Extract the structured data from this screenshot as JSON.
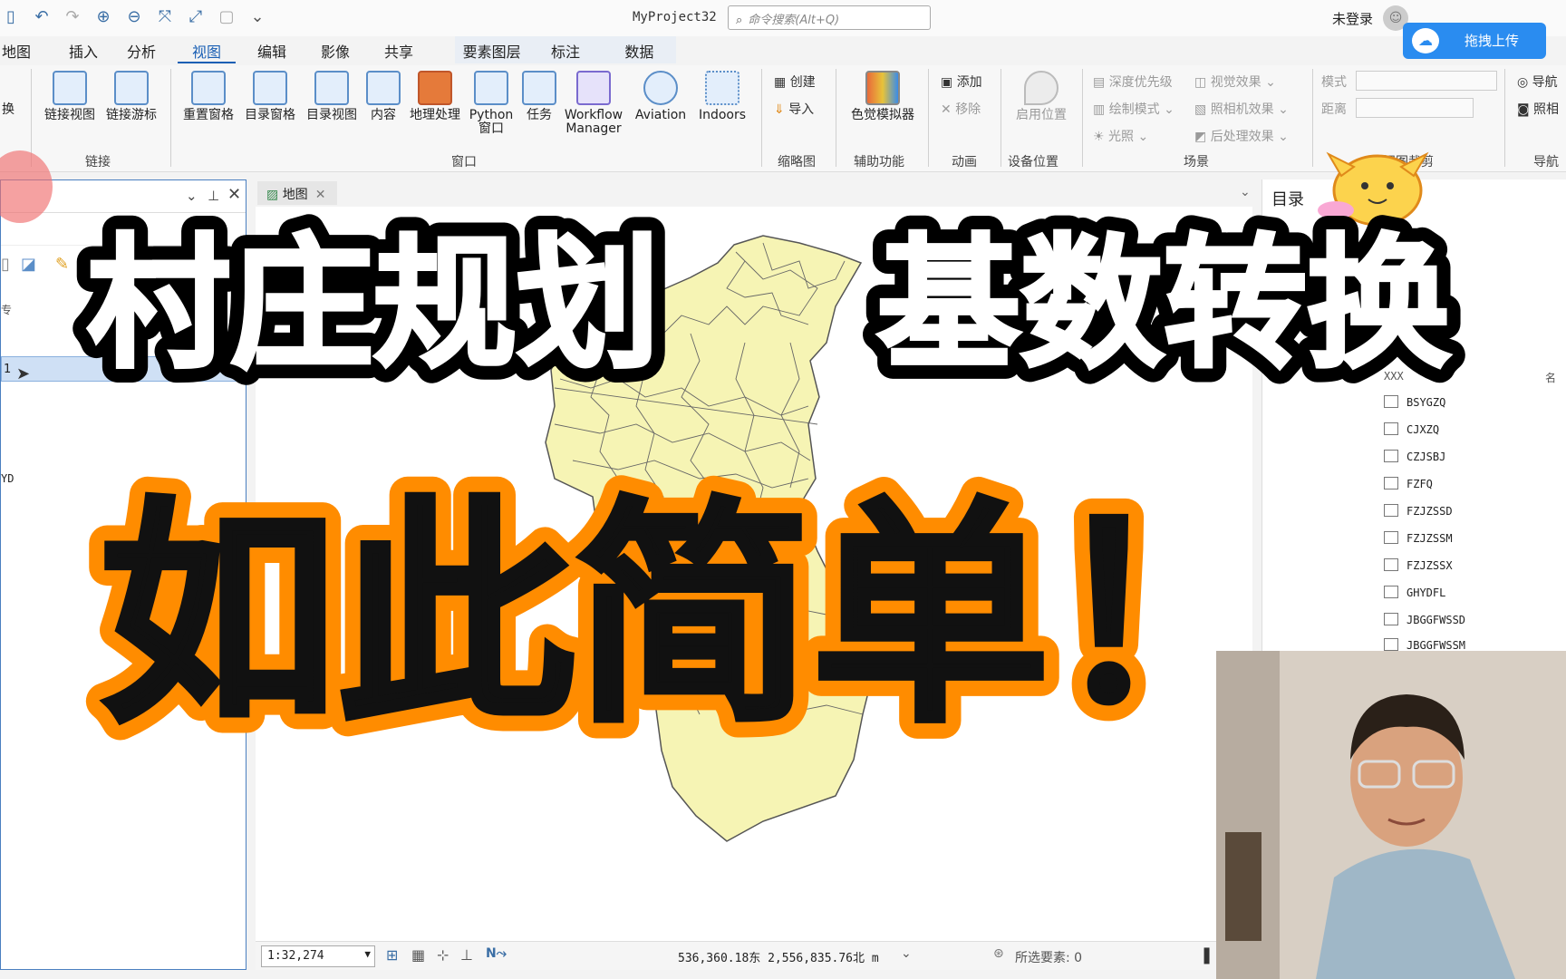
{
  "window": {
    "project_title": "MyProject32",
    "search_placeholder": "命令搜索(Alt+Q)",
    "signin_label": "未登录",
    "upload_button": "拖拽上传"
  },
  "ribbon_tabs": [
    "地图",
    "插入",
    "分析",
    "视图",
    "编辑",
    "影像",
    "共享"
  ],
  "active_tab": "视图",
  "context_tabs": [
    "要素图层",
    "标注",
    "数据"
  ],
  "ribbon": {
    "partial_left_label": "换",
    "link_group": {
      "label": "链接",
      "buttons": [
        "链接视图",
        "链接游标"
      ]
    },
    "window_group": {
      "label": "窗口",
      "buttons": [
        "重置窗格",
        "目录窗格",
        "目录视图",
        "内容",
        "地理处理",
        "Python\n窗口",
        "任务",
        "Workflow\nManager",
        "Aviation",
        "Indoors"
      ]
    },
    "overview_group": {
      "label": "缩略图",
      "buttons": [
        "创建",
        "导入"
      ]
    },
    "accessibility_group": {
      "label": "辅助功能",
      "buttons": [
        "色觉模拟器"
      ]
    },
    "animation_group": {
      "label": "动画",
      "buttons": [
        "添加",
        "移除"
      ]
    },
    "device_group": {
      "label": "设备位置",
      "buttons": [
        "启用位置"
      ]
    },
    "scene_group": {
      "label": "场景",
      "buttons": [
        "深度优先级",
        "视觉效果",
        "绘制模式",
        "照相机效果",
        "光照",
        "后处理效果"
      ]
    },
    "view_clip_group": {
      "label": "视图裁剪",
      "fields": [
        "模式",
        "距离"
      ]
    },
    "nav_group": {
      "label": "导航",
      "buttons": [
        "导航",
        "照相"
      ]
    }
  },
  "left_pane": {
    "selected_item": "1",
    "partial_label": "YD",
    "partial_char": "专"
  },
  "map": {
    "tab_label": "地图",
    "scale": "1:32,274",
    "coordinates": "536,360.18东  2,556,835.76北 m",
    "selected_features": "所选要素: 0"
  },
  "catalog": {
    "title": "目录",
    "partial_row": "XXX",
    "partial_row_right": "名",
    "items": [
      "BSYGZQ",
      "CJXZQ",
      "CZJSBJ",
      "FZFQ",
      "FZJZSSD",
      "FZJZSSM",
      "FZJZSSX",
      "GHYDFL",
      "JBGGFWSSD",
      "JBGGFWSSM"
    ]
  },
  "overlay": {
    "line1_left": "村庄规划",
    "line1_right": "基数转换",
    "line2": "如此简单！"
  },
  "colors": {
    "accent": "#1a5fb4",
    "map_fill": "#f6f4b4",
    "overlay_orange": "#ff8c00",
    "upload_blue": "#2a8cf0"
  }
}
